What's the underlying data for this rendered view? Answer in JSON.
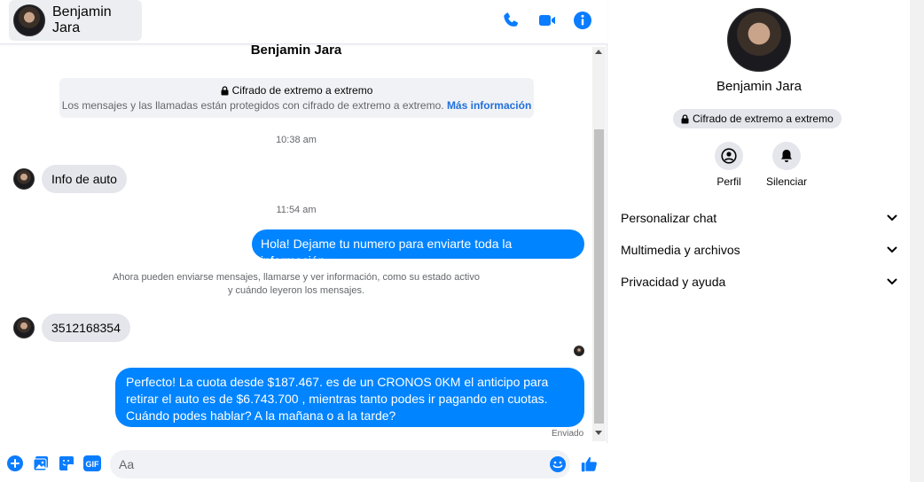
{
  "header": {
    "contact_name": "Benjamin Jara",
    "icons": [
      "phone-icon",
      "video-icon",
      "info-icon"
    ]
  },
  "thread": {
    "top_name": "Benjamin Jara",
    "e2e_title": "Cifrado de extremo a extremo",
    "e2e_desc": "Los mensajes y las llamadas están protegidos con cifrado de extremo a extremo.",
    "e2e_link": "Más información",
    "time1": "10:38 am",
    "msg_in_1": "Info de auto",
    "time2": "11:54 am",
    "msg_out_1": "Hola! Dejame tu numero  para enviarte toda la información.",
    "activity_line1": "Ahora pueden enviarse mensajes, llamarse y ver información, como su estado activo",
    "activity_line2": "y cuándo leyeron los mensajes.",
    "msg_in_2": "3512168354",
    "msg_out_2": "Perfecto! La cuota desde $187.467. es de un CRONOS 0KM el anticipo para retirar el auto es de $6.743.700 , mientras tanto podes ir pagando en cuotas. Cuándo podes hablar? A la mañana o a la tarde?",
    "sent_status": "Enviado"
  },
  "composer": {
    "placeholder": "Aa",
    "icons": [
      "plus-icon",
      "image-icon",
      "sticker-icon",
      "gif-icon",
      "emoji-icon",
      "like-icon"
    ],
    "gif_label": "GIF"
  },
  "details": {
    "name": "Benjamin Jara",
    "e2e_badge": "Cifrado de extremo a extremo",
    "actions": [
      {
        "label": "Perfil",
        "icon": "profile-icon"
      },
      {
        "label": "Silenciar",
        "icon": "bell-icon"
      }
    ],
    "sections": [
      {
        "label": "Personalizar chat"
      },
      {
        "label": "Multimedia y archivos"
      },
      {
        "label": "Privacidad y ayuda"
      }
    ]
  },
  "colors": {
    "accent": "#0084ff",
    "icon_blue": "#0a7cff",
    "bubble_in": "#e4e6eb",
    "link": "#216fdb"
  }
}
